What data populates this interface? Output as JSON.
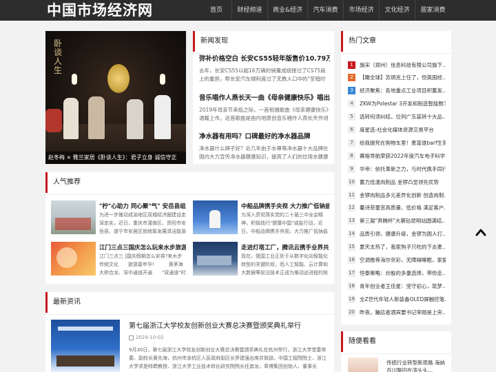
{
  "site": {
    "logo": "中国市场经济网"
  },
  "nav": [
    {
      "label": "首页"
    },
    {
      "label": "财经频道"
    },
    {
      "label": "商业&经济"
    },
    {
      "label": "汽车消费"
    },
    {
      "label": "市场经济"
    },
    {
      "label": "文化经济"
    },
    {
      "label": "居家消费"
    }
  ],
  "hero": {
    "caption": "赵冬梅 × 雅兰家居《卧谈人生》：君子立身 诚信守正",
    "calligraphy": "卧谈人生"
  },
  "news": {
    "title": "新闻发现",
    "items": [
      {
        "title": "弥补价格空白 长安CS55轻年版售价10.79万元",
        "desc": "去年，长安CS55以超16万辆的销量成绩接过了CS75肩上的重担，帮长安汽车顺利度过了无数人口中的\"至暗时刻\"。"
      },
      {
        "title": "音乐唱作人燕长天一曲《母亲健康快乐》唱出万千儿女心声",
        "desc": "2019年母亲节来临之际，一首祝福歌曲《母亲健康快乐》温暖上市。这首歌曲是由内地原创音乐唱作人燕长天作词作曲"
      },
      {
        "title": "净水器有用吗？口碑最好的净水器品牌",
        "desc": "净水器什么牌子好？近几年由于水尊等净水器十大品牌在国内大力宣传净水器健康知识，提高了人们的饮用水健康意"
      }
    ]
  },
  "popular": {
    "title": "人气推荐",
    "items": [
      {
        "title": "\"柠\"心助力 同心聚\"气\" 安岳县组织开展",
        "desc": "为进一步推动成渝地区双城经济圈建设走深走实，近日，重庆市潼南区、资阳市安岳县、遂宁市安居区就统筹发展清洁能源"
      },
      {
        "title": "中船品牌携手央视 大力推广低钠盐",
        "desc": "为深入贯彻落实党的二十届三中全会精神，积极践行\"健康中国\"减盐行动，近日，中船品牌携手央视，大力推广低钠盐"
      },
      {
        "title": "江门三点三国庆怎么玩来水步旅游",
        "desc": "江门三点三 |国庆假期怎么安排?来水步传统文化　　旅游嘉年华!　　　黄茅海大桥合龙、深中通道开通　　\"双通道\"时"
      },
      {
        "title": "走进灯塔工厂，腾讯云携手业界共同探索",
        "desc": "现在，我国工业正处于从数字化向智能化转型的关键阶段，而人工智能、云计算和大数据等前沿技术正成为推动这进程的核"
      }
    ]
  },
  "latest": {
    "title": "最新资讯",
    "items": [
      {
        "title": "第七届浙江大学校友创新创业大赛总决赛暨颁奖典礼举行",
        "date": "2024-10-02",
        "desc": "9月30日，第七届浙江大学校友创新创业大赛总决赛暨颁奖典礼在杭州举行。浙江大学党委常委、副校长黄先海，杭州市余杭区人民政府副区长罗建强出席并致辞。中国工程院院士、浙江大学求是特聘教授、浙江大学工业技术转化研究院院长任其龙，章博集团创始人、董事长"
      }
    ]
  },
  "hot": {
    "title": "热门文章",
    "items": [
      {
        "text": "旗宋（郑州）信息科技有限公司旗下..."
      },
      {
        "text": "【瞰全球】苏炳克上任了，但英国经..."
      },
      {
        "text": "经济聚焦：各地重点工业项目积蓄发..."
      },
      {
        "text": "ZKW为Polestar 3开发和制造智能数字灯"
      },
      {
        "text": "选转何须纠结，位列广东装转十大品..."
      },
      {
        "text": "度星选-社会化媒体资源交易平台"
      },
      {
        "text": "给我提死在购物车里！麦富谁barf生育..."
      },
      {
        "text": "赛格导航荣获2022年度汽车电子科学..."
      },
      {
        "text": "华帝：依托革新之力，与时代携手同行"
      },
      {
        "text": "蓄力低温肉制品 金锣凸显领先优势"
      },
      {
        "text": "金锣肉制品多元差异化创新 创造肉制..."
      },
      {
        "text": "蔓诗菲童宫高质量、低价格 满足客户..."
      },
      {
        "text": "第三届\"奔腾杯\"大赛钻昆明站圆满结..."
      },
      {
        "text": "品质引领，健康升级，金锣为国人打..."
      },
      {
        "text": "夏天太热了，我家狗子只吃的下去麦..."
      },
      {
        "text": "空调推荐海尔京彩，无障碍睡眠，家擅"
      },
      {
        "text": "恒泰策略：炒股的多重选择，带你走..."
      },
      {
        "text": "青年创业者王佳星：坚守初心，筑梦..."
      },
      {
        "text": "全Z世代年轻人新装备OLED屏触控笔..."
      },
      {
        "text": "昨夜，蹦店者酒宾要书记李刚是上央..."
      }
    ]
  },
  "random": {
    "title": "随便看看",
    "items": [
      {
        "text": "传统行业转型新思路 海纳百川聊旧在湾头头..."
      }
    ]
  }
}
